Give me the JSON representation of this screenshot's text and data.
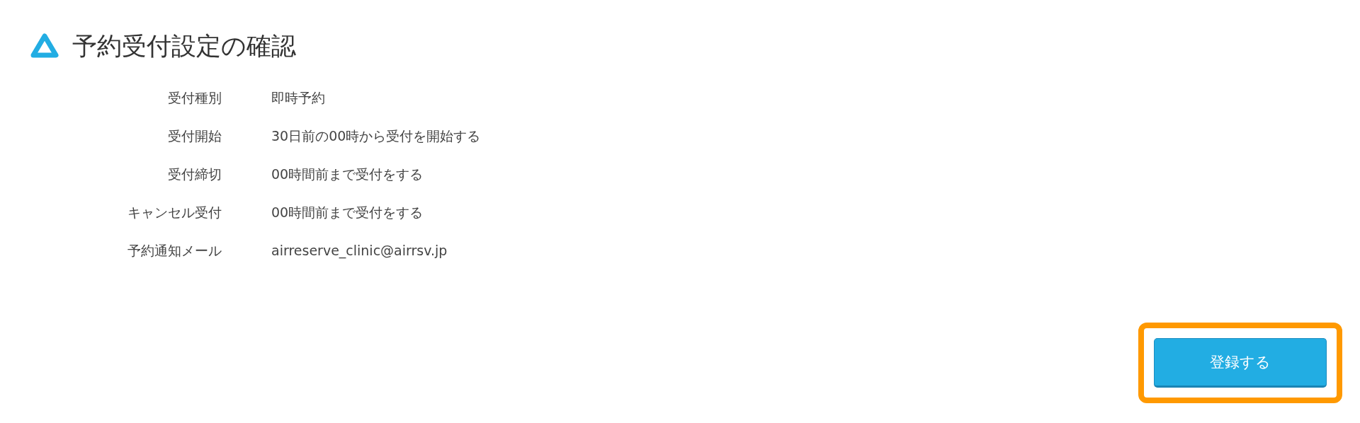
{
  "page": {
    "title": "予約受付設定の確認"
  },
  "settings": [
    {
      "label": "受付種別",
      "value": "即時予約"
    },
    {
      "label": "受付開始",
      "value": "30日前の00時から受付を開始する"
    },
    {
      "label": "受付締切",
      "value": "00時間前まで受付をする"
    },
    {
      "label": "キャンセル受付",
      "value": "00時間前まで受付をする"
    },
    {
      "label": "予約通知メール",
      "value": "airreserve_clinic@airrsv.jp"
    }
  ],
  "submit_button": {
    "label": "登録する",
    "highlighted": true
  }
}
